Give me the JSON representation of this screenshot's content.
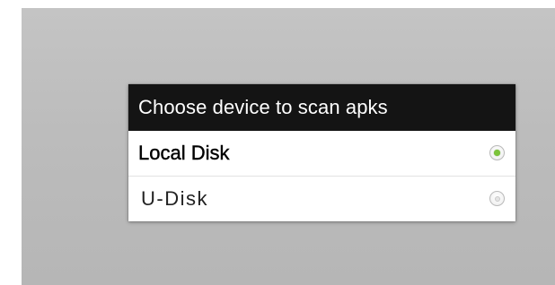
{
  "dialog": {
    "title": "Choose device to scan apks",
    "options": [
      {
        "label": "Local Disk",
        "selected": true,
        "radio_icon": "radio-checked-icon"
      },
      {
        "label": "U-Disk",
        "selected": false,
        "radio_icon": "radio-unchecked-icon"
      }
    ]
  },
  "colors": {
    "title_bar": "#141414",
    "radio_selected": "#7cc43a",
    "backdrop": "#bdbdbd"
  }
}
